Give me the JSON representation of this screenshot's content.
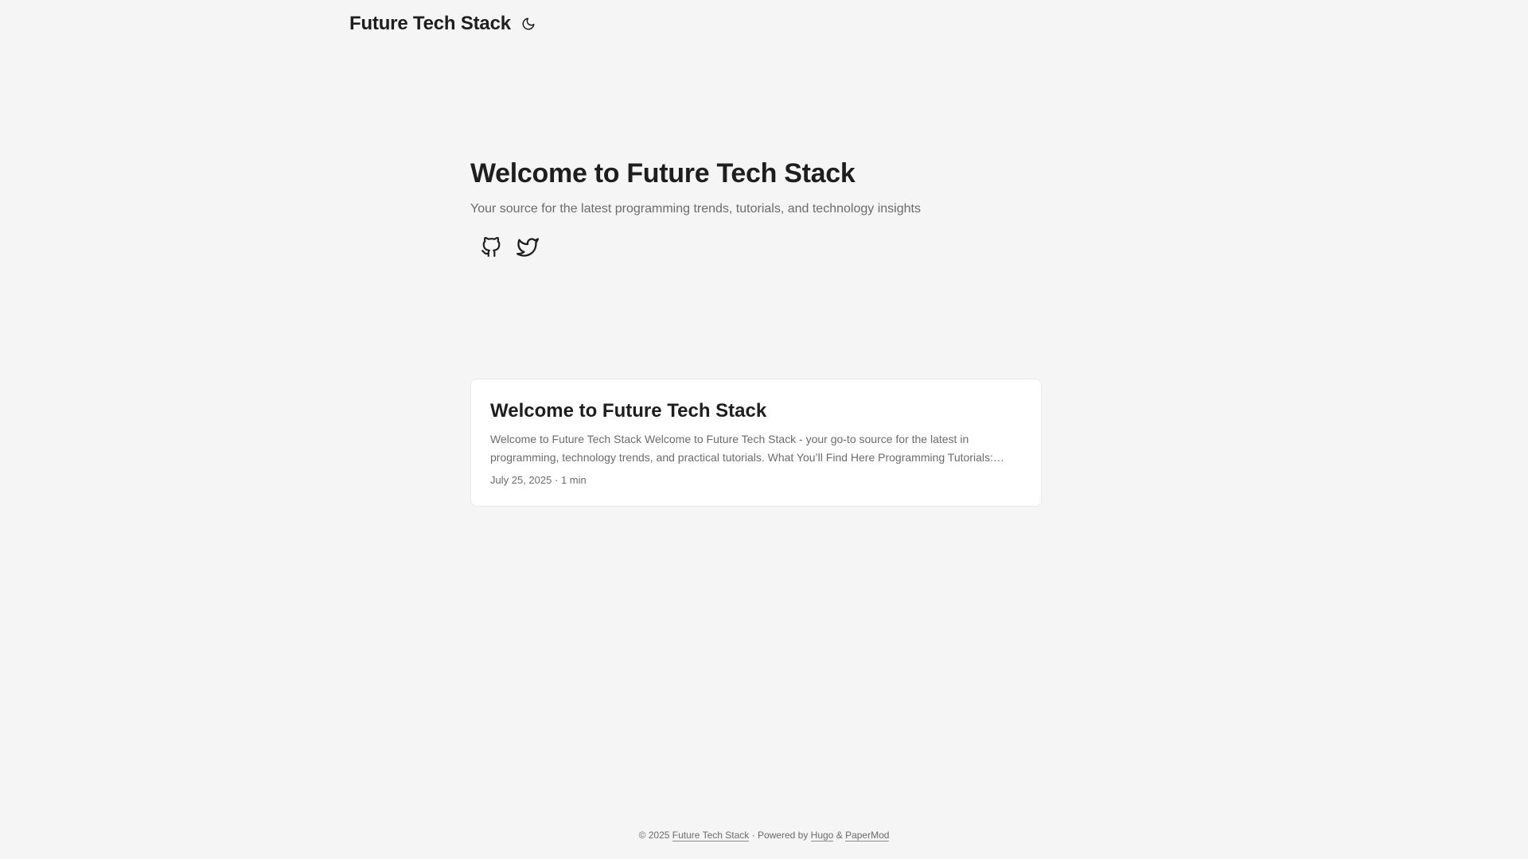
{
  "header": {
    "site_title": "Future Tech Stack",
    "theme_toggle_icon": "moon-icon"
  },
  "home": {
    "title": "Welcome to Future Tech Stack",
    "subtitle": "Your source for the latest programming trends, tutorials, and technology insights",
    "social": [
      {
        "icon": "github-icon"
      },
      {
        "icon": "twitter-icon"
      }
    ]
  },
  "posts": [
    {
      "title": "Welcome to Future Tech Stack",
      "summary": "Welcome to Future Tech Stack Welcome to Future Tech Stack - your go-to source for the latest in programming, technology trends, and practical tutorials. What You’ll Find Here Programming Tutorials: Step-by-step guides",
      "date": "July 25, 2025",
      "separator": "·",
      "reading_time": "1 min"
    }
  ],
  "footer": {
    "copyright": "© 2025",
    "site_link": "Future Tech Stack",
    "powered_by": "· Powered by",
    "hugo_link": "Hugo",
    "ampersand": "&",
    "theme_link": "PaperMod"
  },
  "colors": {
    "background": "#f5f5f5",
    "card": "#ffffff",
    "primary_text": "#1e1e1e",
    "secondary_text": "#6b6b6b",
    "border": "#e9e9e9"
  }
}
